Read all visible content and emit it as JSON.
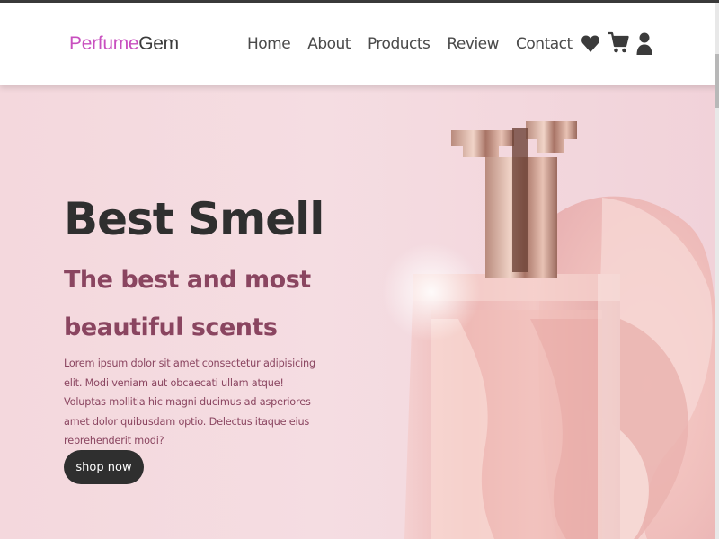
{
  "brand": {
    "part1": "Perfume",
    "part2": "Gem"
  },
  "nav": {
    "items": [
      "Home",
      "About",
      "Products",
      "Review",
      "Contact"
    ]
  },
  "header_icons": [
    "heart-icon",
    "cart-icon",
    "user-icon"
  ],
  "hero": {
    "title": "Best Smell",
    "subtitle": "The best and most beautiful scents",
    "paragraph": "Lorem ipsum dolor sit amet consectetur adipisicing elit. Modi veniam aut obcaecati ullam atque! Voluptas mollitia hic magni ducimus ad asperiores amet dolor quibusdam optio. Delectus itaque eius reprehenderit modi?",
    "button": "shop now"
  },
  "colors": {
    "brand_accent": "#c84fbf",
    "hero_bg": "#f4d8dd",
    "subtitle": "#8a4560",
    "button_bg": "#2f2f2f"
  }
}
